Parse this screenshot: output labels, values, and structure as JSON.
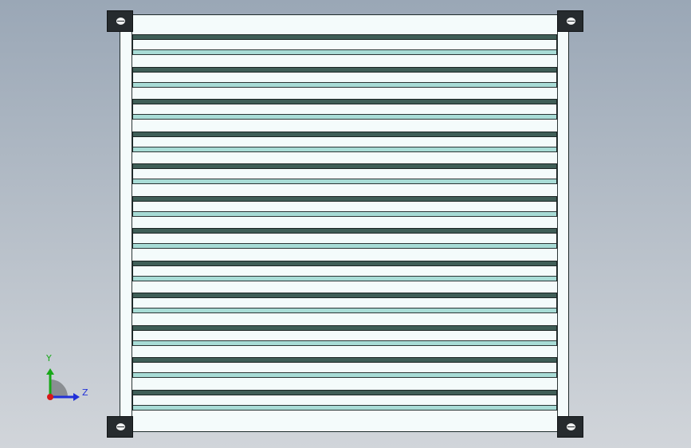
{
  "model": {
    "part": "louver-panel",
    "view": "front",
    "slat_count": 12,
    "colors": {
      "background_top": "#9aa7b6",
      "background_bottom": "#d1d5da",
      "frame_face": "#f4fbfb",
      "slat_top_band": "#3f5e57",
      "slat_bottom_band": "#a8dcd6",
      "bracket": "#262b2e",
      "outline": "#1e2a2a"
    }
  },
  "triad": {
    "y_label": "Y",
    "z_label": "Z",
    "colors": {
      "y_axis": "#18a818",
      "z_axis": "#2030d8",
      "origin": "#d81818",
      "plane": "#8a8e92"
    }
  }
}
